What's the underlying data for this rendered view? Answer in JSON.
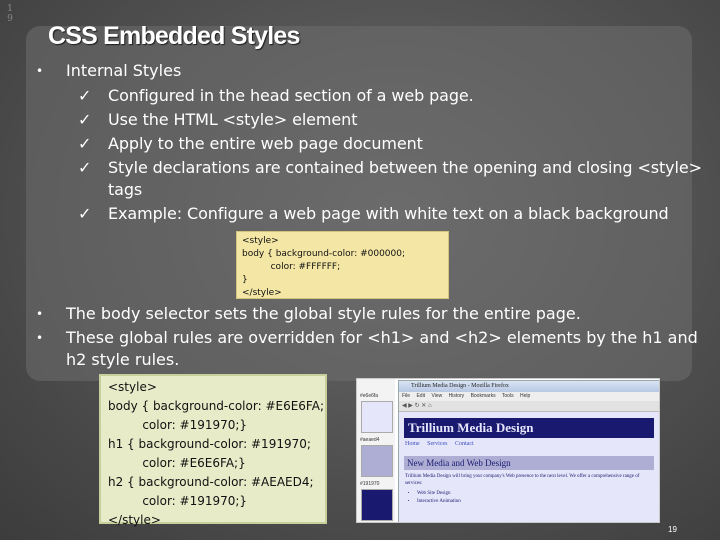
{
  "slide": {
    "index_digits": [
      "1",
      "9"
    ],
    "title": "CSS Embedded Styles",
    "page_number": "19"
  },
  "bullets": {
    "bullet_glyph": "•",
    "check_glyph": "✓",
    "main": "Internal Styles",
    "checks": [
      "Configured in the head section of a web page.",
      "Use the HTML <style> element",
      "Apply to the entire web page document",
      "Style declarations are contained between the opening and closing <style> tags",
      "Example: Configure a web page with white text on a black background"
    ]
  },
  "code_example1": {
    "lines": [
      "<style>",
      "body { background-color: #000000;",
      "          color: #FFFFFF;",
      "}",
      "</style>"
    ]
  },
  "bullets2": [
    "The body selector sets the global style rules for the entire page.",
    "These global rules are overridden for <h1> and <h2> elements by the h1 and h2 style rules."
  ],
  "code_example2": {
    "lines": [
      "<style>",
      "body { background-color: #E6E6FA;",
      "         color: #191970;}",
      "h1 { background-color: #191970;",
      "         color: #E6E6FA;}",
      "h2 { background-color: #AEAED4;",
      "         color: #191970;}",
      "</style>"
    ]
  },
  "screenshot": {
    "swatches": [
      {
        "label": "#e6e6fa",
        "color": "#e6e6fa"
      },
      {
        "label": "#aeaed4",
        "color": "#aeaed4"
      },
      {
        "label": "#191970",
        "color": "#191970"
      }
    ],
    "browser_title": "Trillium Media Design - Mozilla Firefox",
    "menu": [
      "File",
      "Edit",
      "View",
      "History",
      "Bookmarks",
      "Tools",
      "Help"
    ],
    "h1": "Trillium Media Design",
    "nav": [
      "Home",
      "Services",
      "Contact"
    ],
    "h2": "New Media and Web Design",
    "paragraph": "Trillium Media Design will bring your company's Web presence to the next level. We offer a comprehensive range of services:",
    "list": [
      "Web Site Design",
      "Interactive Animation"
    ]
  }
}
